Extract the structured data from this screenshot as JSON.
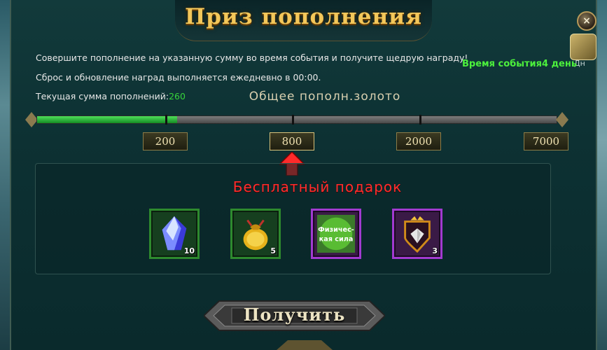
{
  "window": {
    "title": "Приз пополнения",
    "close_icon": "×",
    "side_label": "Дн"
  },
  "info": {
    "line1": "Совершите пополнение на указанную сумму во время события и получите щедрую награду!",
    "line2": "Сброс и обновление наград выполняется ежедневно в 00:00.",
    "current_label": "Текущая сумма пополнений:",
    "current_value": "260",
    "event_time": "Время события4 день"
  },
  "progress": {
    "title": "Общее пополн.золото",
    "current": 260,
    "max": 7000,
    "fill_fraction": 0.27,
    "tiers": [
      "200",
      "800",
      "2000",
      "7000"
    ],
    "selected_tier": "800"
  },
  "rewards": {
    "title": "Бесплатный подарок",
    "items": [
      {
        "icon": "crystal-icon",
        "count": "10",
        "frame": "green"
      },
      {
        "icon": "gold-bag-icon",
        "count": "5",
        "frame": "green"
      },
      {
        "icon": "physical-strength-icon",
        "label": "Физичес-\nкая сила",
        "count": "",
        "frame": "purple"
      },
      {
        "icon": "diamond-crest-icon",
        "count": "3",
        "frame": "purple"
      }
    ]
  },
  "actions": {
    "claim_label": "Получить"
  },
  "colors": {
    "title_gold": "#f3c75a",
    "gift_red": "#ff2d2d",
    "progress_green": "#37d43b",
    "event_green": "#4cf03c"
  }
}
